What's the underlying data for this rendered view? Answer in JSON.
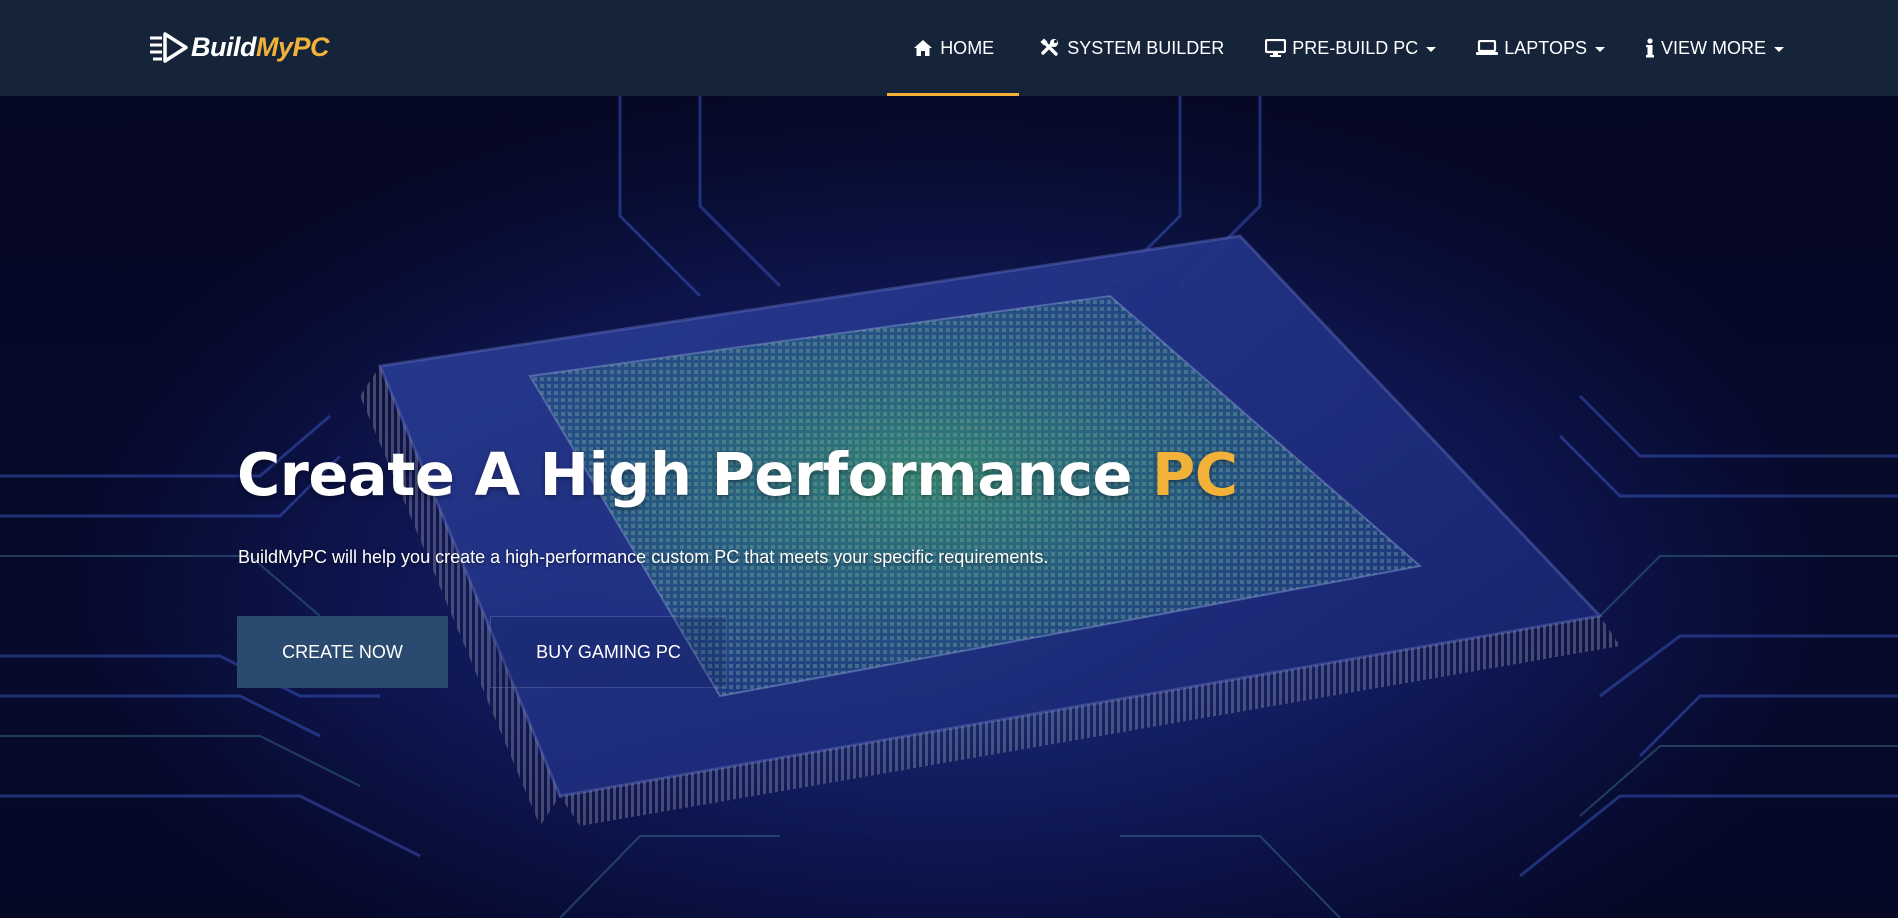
{
  "brand": {
    "name_part1": "Build",
    "name_part2": "MyPC",
    "logo_icon": "speed-play-icon",
    "accent_color": "#f2b23a"
  },
  "nav": {
    "items": [
      {
        "label": "HOME",
        "icon": "home-icon",
        "active": true,
        "dropdown": false
      },
      {
        "label": "SYSTEM BUILDER",
        "icon": "tools-icon",
        "active": false,
        "dropdown": false
      },
      {
        "label": "PRE-BUILD PC",
        "icon": "monitor-icon",
        "active": false,
        "dropdown": true
      },
      {
        "label": "LAPTOPS",
        "icon": "laptop-icon",
        "active": false,
        "dropdown": true
      },
      {
        "label": "VIEW MORE",
        "icon": "info-icon",
        "active": false,
        "dropdown": true
      }
    ],
    "background": "#16243a"
  },
  "hero": {
    "title_main": "Create A High Performance ",
    "title_accent": "PC",
    "subtitle": "BuildMyPC will help you create a high-performance custom PC that meets your specific requirements.",
    "primary_button": "CREATE NOW",
    "secondary_button": "BUY GAMING PC",
    "background_image": "circuit-board-cpu"
  }
}
